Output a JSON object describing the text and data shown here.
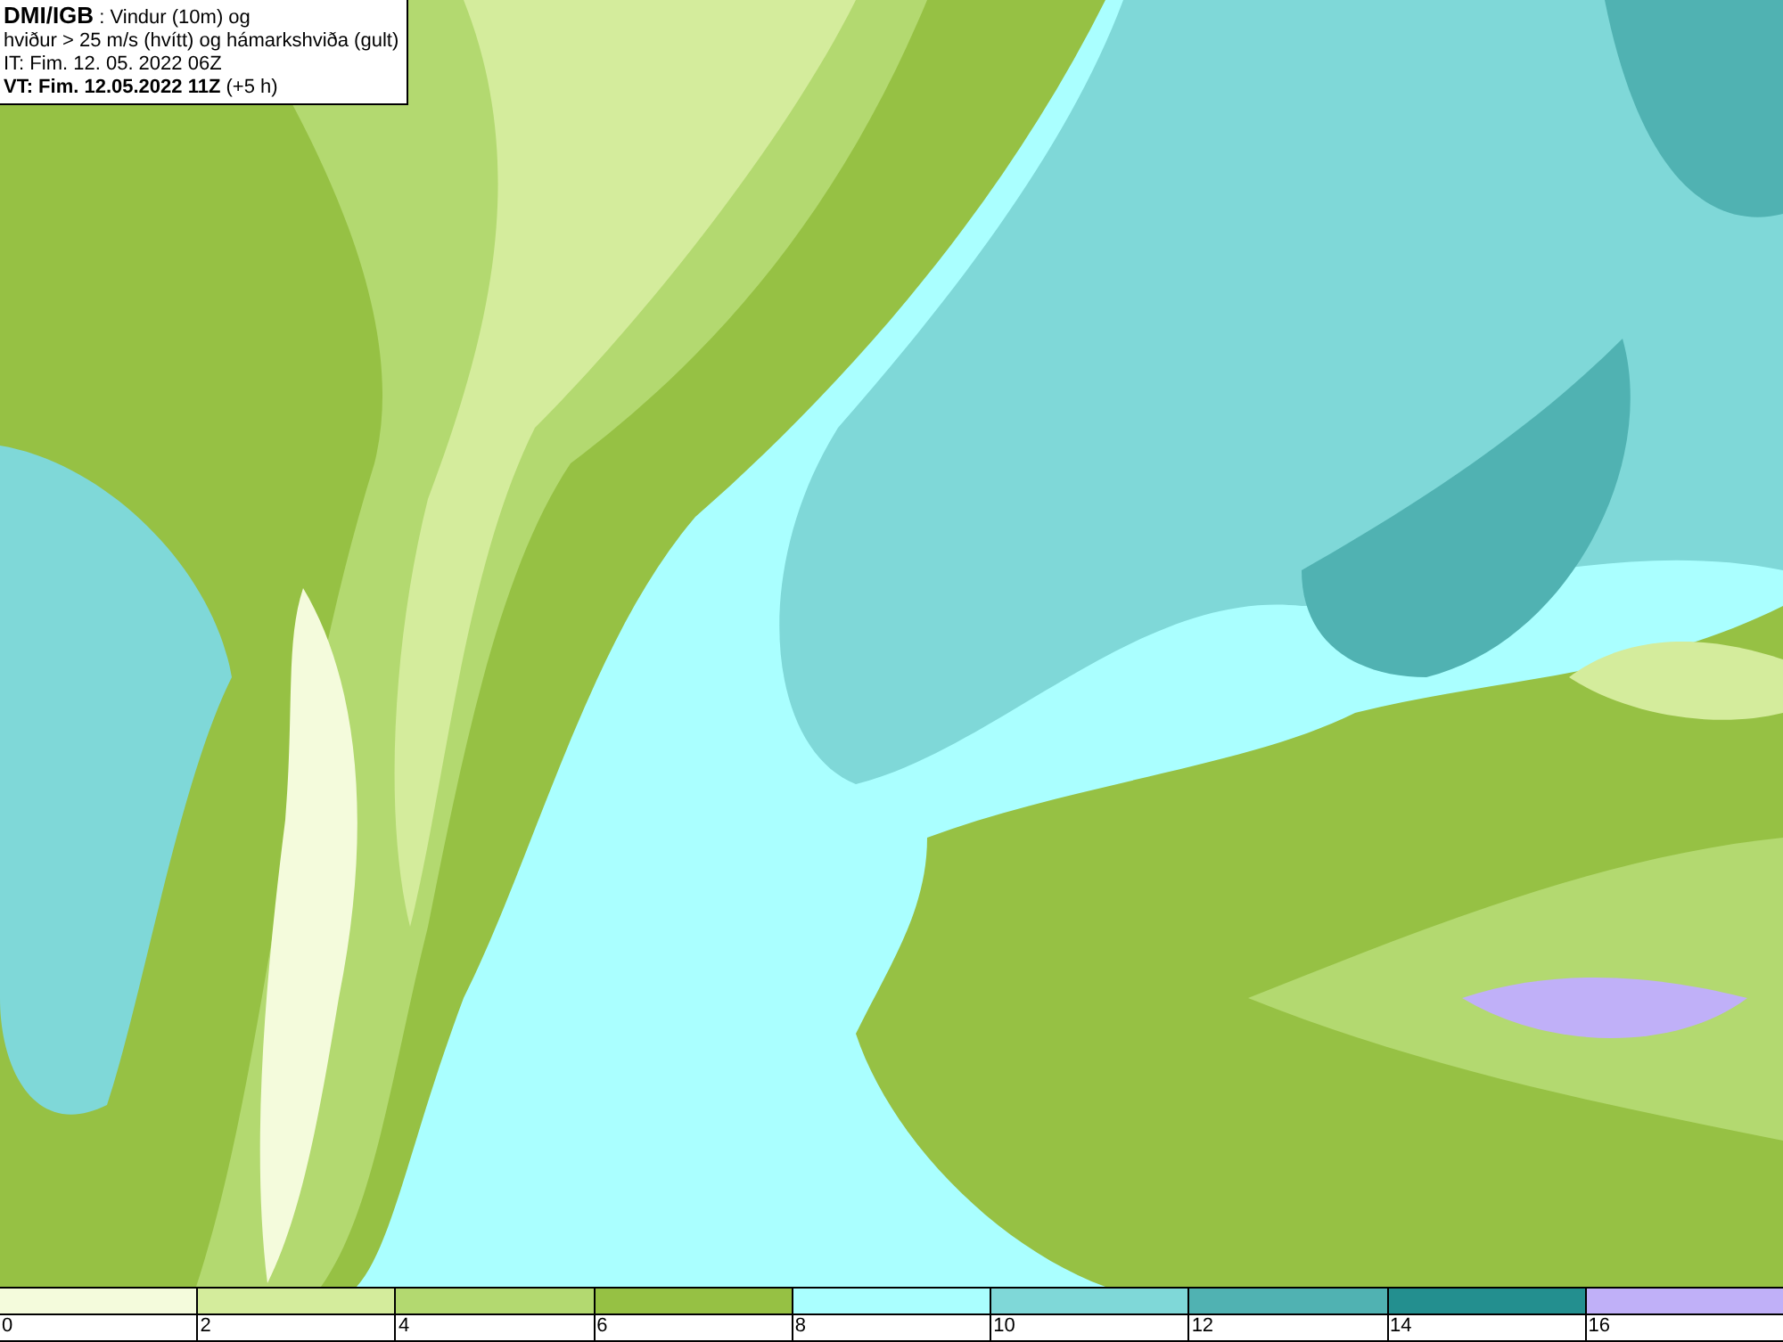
{
  "legend": {
    "lines": [
      "**DMI/IGB** : Vindur (10m) og",
      "hviður > 25 m/s (hvítt) og hámarkshviða (gult)",
      "IT: Fim. 12. 05. 2022 06Z",
      "**VT: Fim. 12.05.2022 11Z** (+5 h)"
    ]
  },
  "scale": [
    {
      "label": "0",
      "color": "#f4fbdc"
    },
    {
      "label": "2",
      "color": "#d4ec9c"
    },
    {
      "label": "4",
      "color": "#b3d970"
    },
    {
      "label": "6",
      "color": "#96c144"
    },
    {
      "label": "8",
      "color": "#aaffff"
    },
    {
      "label": "10",
      "color": "#7fd8d8"
    },
    {
      "label": "12",
      "color": "#50b2b2"
    },
    {
      "label": "14",
      "color": "#238f8f"
    },
    {
      "label": "16",
      "color": "#c0b0f8"
    }
  ]
}
